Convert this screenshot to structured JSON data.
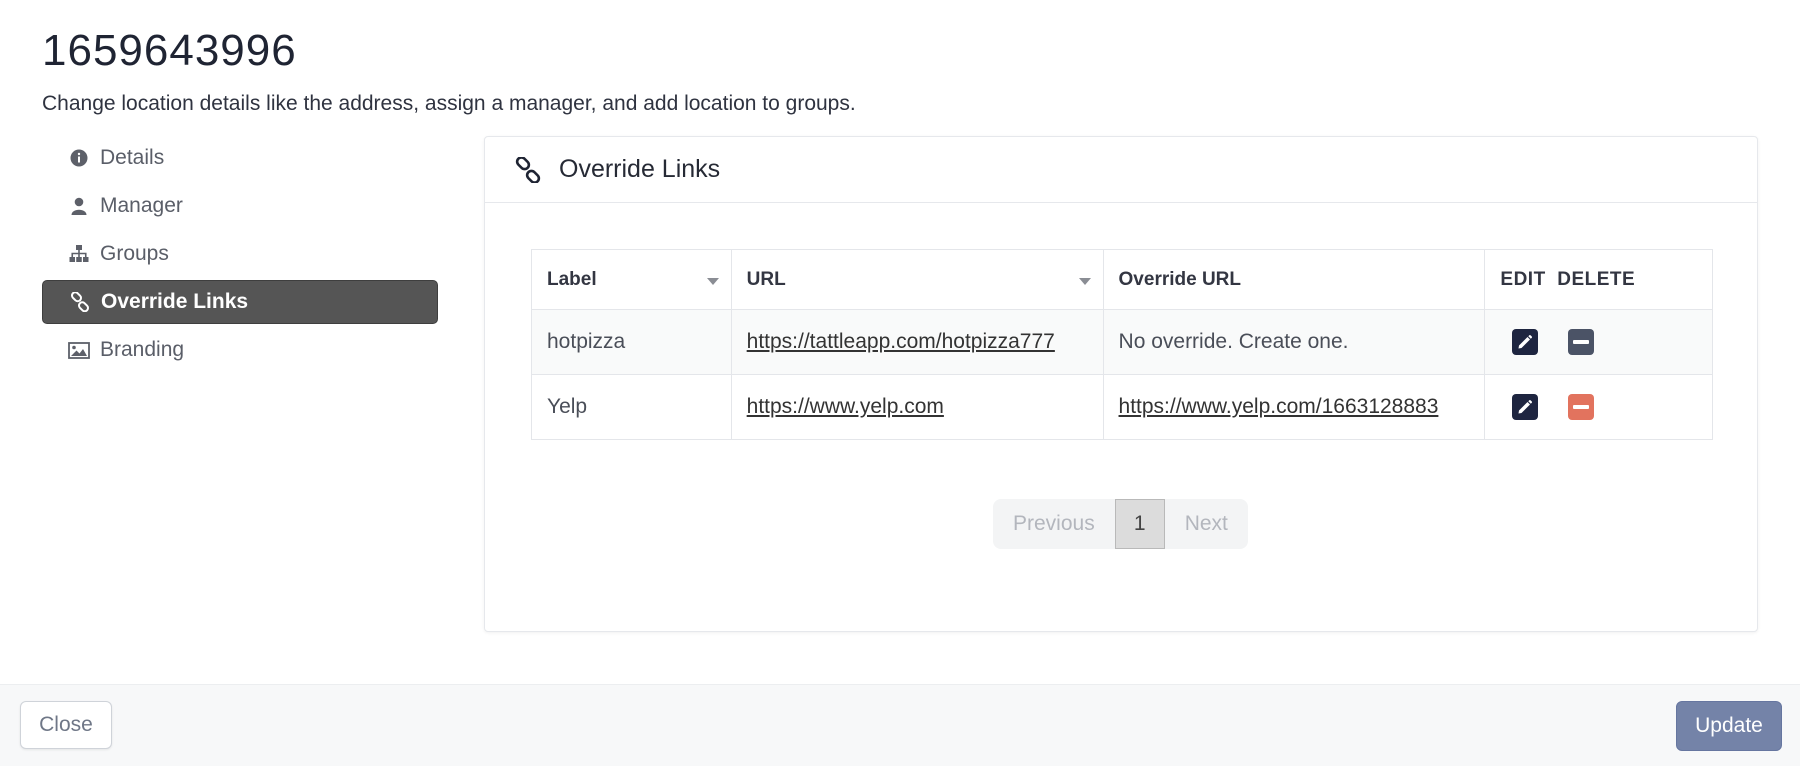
{
  "header": {
    "title": "1659643996",
    "subtitle": "Change location details like the address, assign a manager, and add location to groups."
  },
  "sidebar": {
    "items": [
      {
        "label": "Details",
        "icon": "info-circle-icon"
      },
      {
        "label": "Manager",
        "icon": "user-icon"
      },
      {
        "label": "Groups",
        "icon": "sitemap-icon"
      },
      {
        "label": "Override Links",
        "icon": "link-icon",
        "active": true
      },
      {
        "label": "Branding",
        "icon": "image-icon"
      }
    ]
  },
  "card": {
    "title": "Override Links",
    "icon": "link-icon"
  },
  "table": {
    "columns": {
      "label": "Label",
      "url": "URL",
      "override_url": "Override URL",
      "edit": "EDIT",
      "delete": "DELETE"
    },
    "rows": [
      {
        "label": "hotpizza",
        "url": "https://tattleapp.com/hotpizza777",
        "override_url": "No override. Create one."
      },
      {
        "label": "Yelp",
        "url": "https://www.yelp.com",
        "override_url": "https://www.yelp.com/1663128883"
      }
    ]
  },
  "pagination": {
    "previous": "Previous",
    "current": "1",
    "next": "Next"
  },
  "footer": {
    "close_label": "Close",
    "update_label": "Update"
  },
  "colors": {
    "active_nav": "#555555",
    "edit_button": "#1e2540",
    "delete_button": "#4b5366",
    "delete_button_active": "#e2735e",
    "update_button": "#7483a8"
  }
}
